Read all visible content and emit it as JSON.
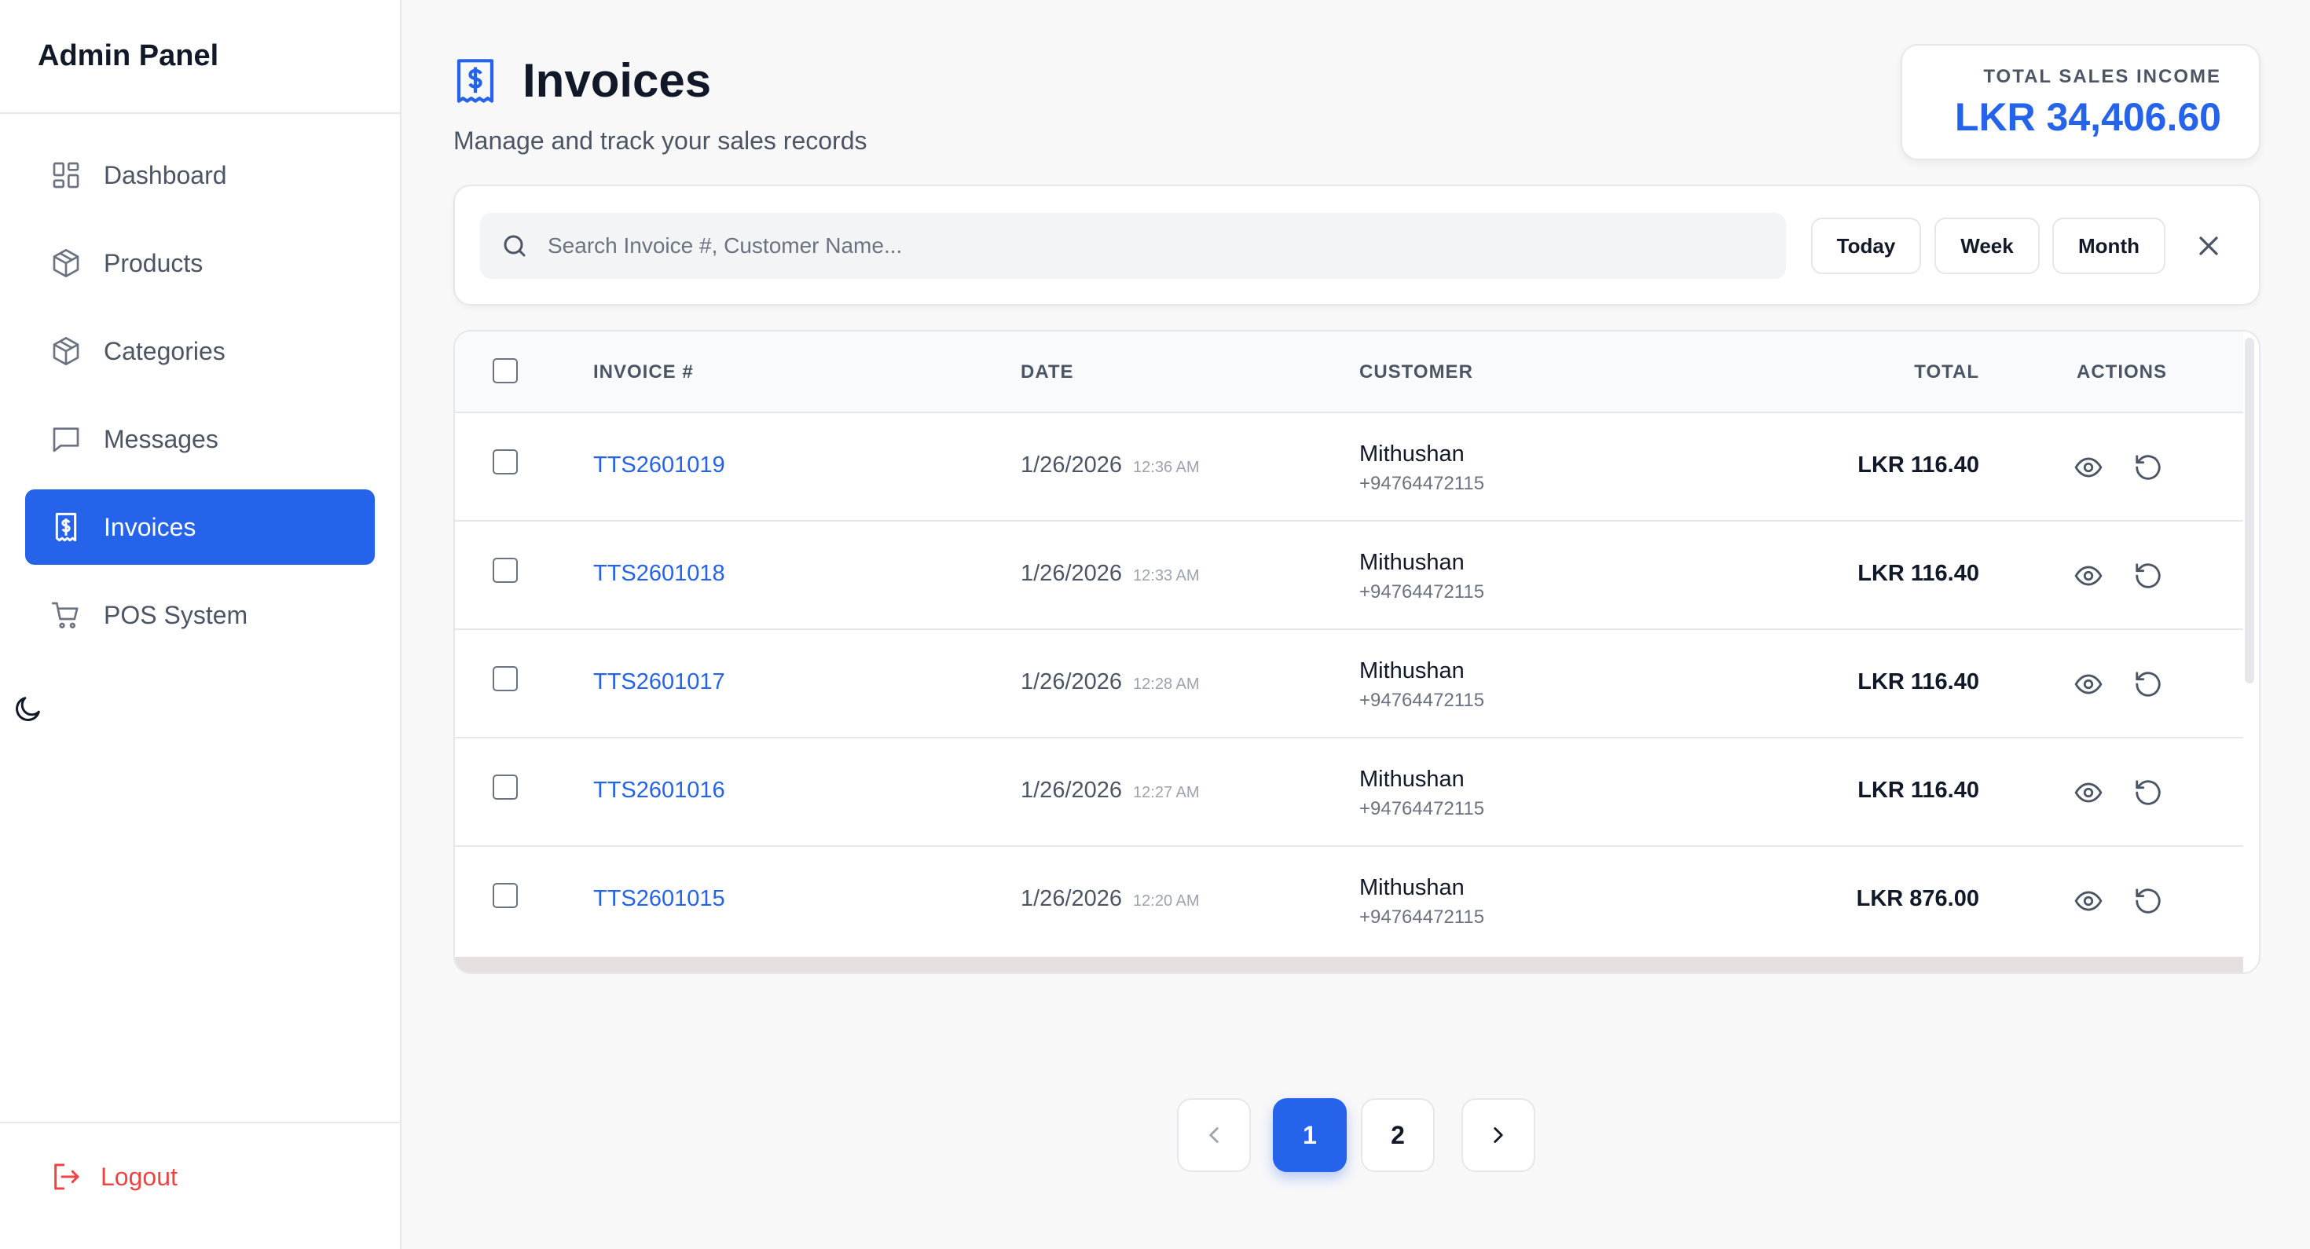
{
  "sidebar": {
    "brand": "Admin Panel",
    "items": [
      {
        "label": "Dashboard",
        "icon": "dashboard-icon"
      },
      {
        "label": "Products",
        "icon": "box-icon"
      },
      {
        "label": "Categories",
        "icon": "box-icon"
      },
      {
        "label": "Messages",
        "icon": "message-icon"
      },
      {
        "label": "Invoices",
        "icon": "invoice-icon",
        "active": true
      },
      {
        "label": "POS System",
        "icon": "cart-icon"
      }
    ],
    "theme_toggle_icon": "moon-icon",
    "logout_label": "Logout"
  },
  "header": {
    "title": "Invoices",
    "subtitle": "Manage and track your sales records"
  },
  "income": {
    "label": "TOTAL SALES INCOME",
    "value": "LKR 34,406.60"
  },
  "filters": {
    "search_placeholder": "Search Invoice #, Customer Name...",
    "today": "Today",
    "week": "Week",
    "month": "Month"
  },
  "table": {
    "columns": {
      "invoice": "INVOICE #",
      "date": "DATE",
      "customer": "CUSTOMER",
      "total": "TOTAL",
      "actions": "ACTIONS"
    },
    "rows": [
      {
        "invoice": "TTS2601019",
        "date": "1/26/2026",
        "time": "12:36 AM",
        "customer": "Mithushan",
        "phone": "+94764472115",
        "total": "LKR 116.40"
      },
      {
        "invoice": "TTS2601018",
        "date": "1/26/2026",
        "time": "12:33 AM",
        "customer": "Mithushan",
        "phone": "+94764472115",
        "total": "LKR 116.40"
      },
      {
        "invoice": "TTS2601017",
        "date": "1/26/2026",
        "time": "12:28 AM",
        "customer": "Mithushan",
        "phone": "+94764472115",
        "total": "LKR 116.40"
      },
      {
        "invoice": "TTS2601016",
        "date": "1/26/2026",
        "time": "12:27 AM",
        "customer": "Mithushan",
        "phone": "+94764472115",
        "total": "LKR 116.40"
      },
      {
        "invoice": "TTS2601015",
        "date": "1/26/2026",
        "time": "12:20 AM",
        "customer": "Mithushan",
        "phone": "+94764472115",
        "total": "LKR 876.00"
      }
    ]
  },
  "pagination": {
    "pages": [
      "1",
      "2"
    ],
    "current": "1"
  },
  "colors": {
    "accent": "#2563eb",
    "danger": "#ef4444"
  }
}
